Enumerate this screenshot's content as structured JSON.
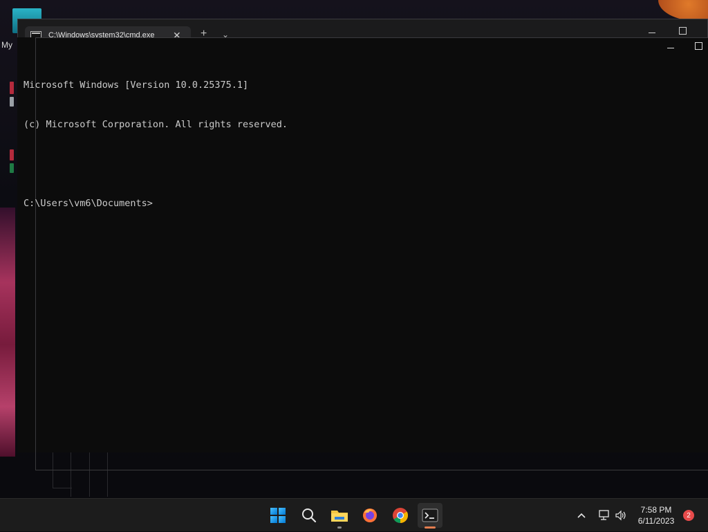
{
  "desktop": {
    "shortcut_label": "My"
  },
  "back_window": {
    "tab_title": "C:\\Windows\\system32\\cmd.exe",
    "tab_close": "✕",
    "tab_add": "+",
    "tab_dropdown": "⌄"
  },
  "console": {
    "lines": [
      "Microsoft Windows [Version 10.0.25375.1]",
      "(c) Microsoft Corporation. All rights reserved.",
      "",
      "C:\\Users\\vm6\\Documents>"
    ]
  },
  "taskbar": {
    "apps": [
      {
        "name": "start",
        "icon": "windows-start-icon"
      },
      {
        "name": "search",
        "icon": "search-icon"
      },
      {
        "name": "file-explorer",
        "icon": "folder-icon"
      },
      {
        "name": "firefox",
        "icon": "firefox-icon"
      },
      {
        "name": "chrome",
        "icon": "chrome-icon"
      },
      {
        "name": "terminal",
        "icon": "terminal-icon"
      }
    ],
    "clock": {
      "time": "7:58 PM",
      "date": "6/11/2023"
    },
    "notification_count": "2",
    "accent_color": "#e37d4f",
    "running_color": "#8a8a8a"
  }
}
